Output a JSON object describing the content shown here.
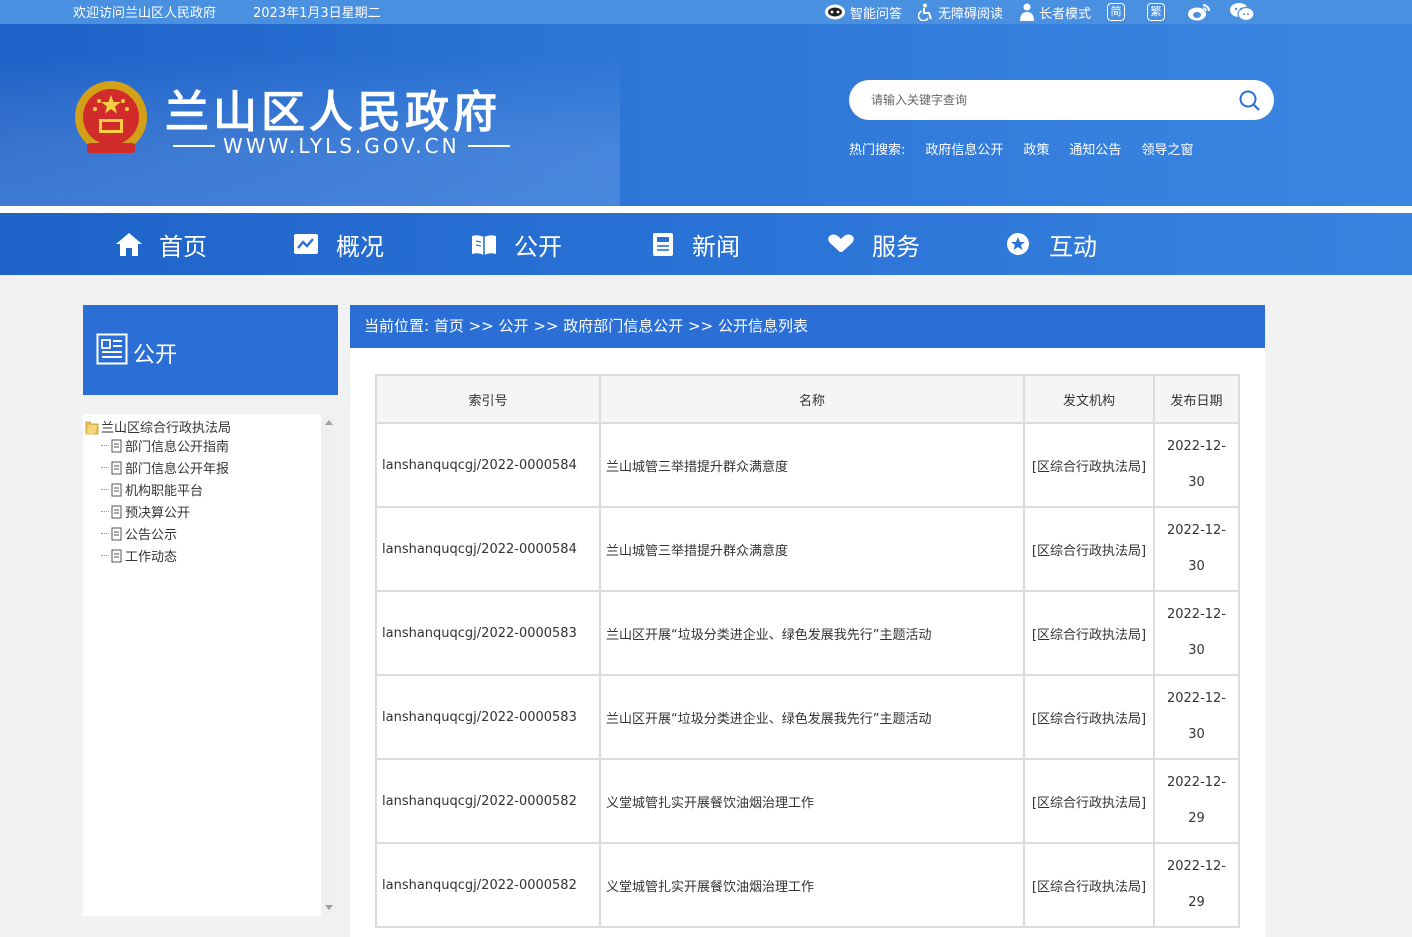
{
  "topbar": {
    "welcome": "欢迎访问兰山区人民政府",
    "date": "2023年1月3日星期二",
    "tools": [
      {
        "label": "智能问答",
        "icon": "robot-icon"
      },
      {
        "label": "无障碍阅读",
        "icon": "accessibility-icon"
      },
      {
        "label": "长者模式",
        "icon": "elder-icon"
      }
    ],
    "simplified": "简",
    "traditional": "繁",
    "weibo_icon": "weibo-icon",
    "wechat_icon": "wechat-icon"
  },
  "header": {
    "title": "兰山区人民政府",
    "url": "WWW.LYLS.GOV.CN",
    "search_placeholder": "请输入关键字查询",
    "hot_label": "热门搜索:",
    "hot_links": [
      "政府信息公开",
      "政策",
      "通知公告",
      "领导之窗"
    ]
  },
  "nav": [
    {
      "label": "首页",
      "icon": "home-icon"
    },
    {
      "label": "概况",
      "icon": "overview-icon"
    },
    {
      "label": "公开",
      "icon": "open-book-icon"
    },
    {
      "label": "新闻",
      "icon": "news-icon"
    },
    {
      "label": "服务",
      "icon": "heart-hand-icon"
    },
    {
      "label": "互动",
      "icon": "chat-star-icon"
    }
  ],
  "sidebar": {
    "title": "公开",
    "root": "兰山区综合行政执法局",
    "items": [
      "部门信息公开指南",
      "部门信息公开年报",
      "机构职能平台",
      "预决算公开",
      "公告公示",
      "工作动态"
    ]
  },
  "breadcrumb": {
    "prefix": "当前位置: ",
    "parts": [
      "首页",
      "公开",
      "政府部门信息公开",
      "公开信息列表"
    ],
    "sep": " >> "
  },
  "table": {
    "headers": [
      "索引号",
      "名称",
      "发文机构",
      "发布日期"
    ],
    "rows": [
      [
        "lanshanquqcgj/2022-0000584",
        "兰山城管三举措提升群众满意度",
        "[区综合行政执法局]",
        "2022-12-30"
      ],
      [
        "lanshanquqcgj/2022-0000584",
        "兰山城管三举措提升群众满意度",
        "[区综合行政执法局]",
        "2022-12-30"
      ],
      [
        "lanshanquqcgj/2022-0000583",
        "兰山区开展“垃圾分类进企业、绿色发展我先行”主题活动",
        "[区综合行政执法局]",
        "2022-12-30"
      ],
      [
        "lanshanquqcgj/2022-0000583",
        "兰山区开展“垃圾分类进企业、绿色发展我先行”主题活动",
        "[区综合行政执法局]",
        "2022-12-30"
      ],
      [
        "lanshanquqcgj/2022-0000582",
        "义堂城管扎实开展餐饮油烟治理工作",
        "[区综合行政执法局]",
        "2022-12-29"
      ],
      [
        "lanshanquqcgj/2022-0000582",
        "义堂城管扎实开展餐饮油烟治理工作",
        "[区综合行政执法局]",
        "2022-12-29"
      ]
    ]
  }
}
